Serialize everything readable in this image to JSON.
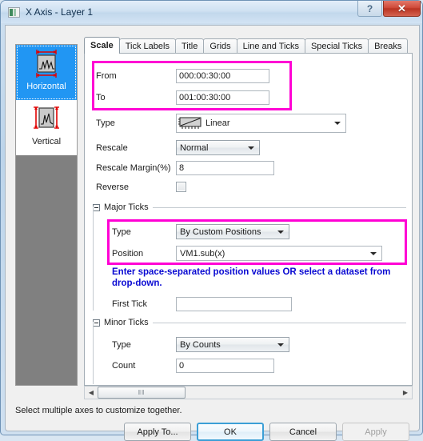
{
  "window": {
    "title": "X Axis - Layer 1",
    "icon": "axis-dialog-icon",
    "help_label": "?",
    "close_label": "✕"
  },
  "sidebar": {
    "items": [
      {
        "label": "Horizontal",
        "icon": "horizontal-axis-icon",
        "selected": true
      },
      {
        "label": "Vertical",
        "icon": "vertical-axis-icon",
        "selected": false
      }
    ]
  },
  "tabs": [
    {
      "label": "Scale",
      "active": true
    },
    {
      "label": "Tick Labels",
      "active": false
    },
    {
      "label": "Title",
      "active": false
    },
    {
      "label": "Grids",
      "active": false
    },
    {
      "label": "Line and Ticks",
      "active": false
    },
    {
      "label": "Special Ticks",
      "active": false
    },
    {
      "label": "Breaks",
      "active": false
    }
  ],
  "scale": {
    "from_label": "From",
    "from_value": "000:00:30:00",
    "to_label": "To",
    "to_value": "001:00:30:00",
    "type_label": "Type",
    "type_value": "Linear",
    "type_icon": "linear-scale-icon",
    "rescale_label": "Rescale",
    "rescale_value": "Normal",
    "rescale_margin_label": "Rescale Margin(%)",
    "rescale_margin_value": "8",
    "reverse_label": "Reverse",
    "reverse_checked": false
  },
  "major_ticks": {
    "group_label": "Major Ticks",
    "type_label": "Type",
    "type_value": "By Custom Positions",
    "position_label": "Position",
    "position_value": "VM1.sub(x)",
    "hint": "Enter space-separated position values OR select a dataset from drop-down.",
    "first_tick_label": "First Tick",
    "first_tick_value": ""
  },
  "minor_ticks": {
    "group_label": "Minor Ticks",
    "type_label": "Type",
    "type_value": "By Counts",
    "count_label": "Count",
    "count_value": "0"
  },
  "scrollbar": {
    "left_arrow": "◀",
    "right_arrow": "▶",
    "grip": "‖‖"
  },
  "footer": {
    "status": "Select multiple axes to customize together.",
    "apply_to_label": "Apply To...",
    "ok_label": "OK",
    "cancel_label": "Cancel",
    "apply_label": "Apply"
  },
  "colors": {
    "highlight": "#ff00d4",
    "hint_text": "#0a0ad2",
    "selection": "#2196f3"
  }
}
